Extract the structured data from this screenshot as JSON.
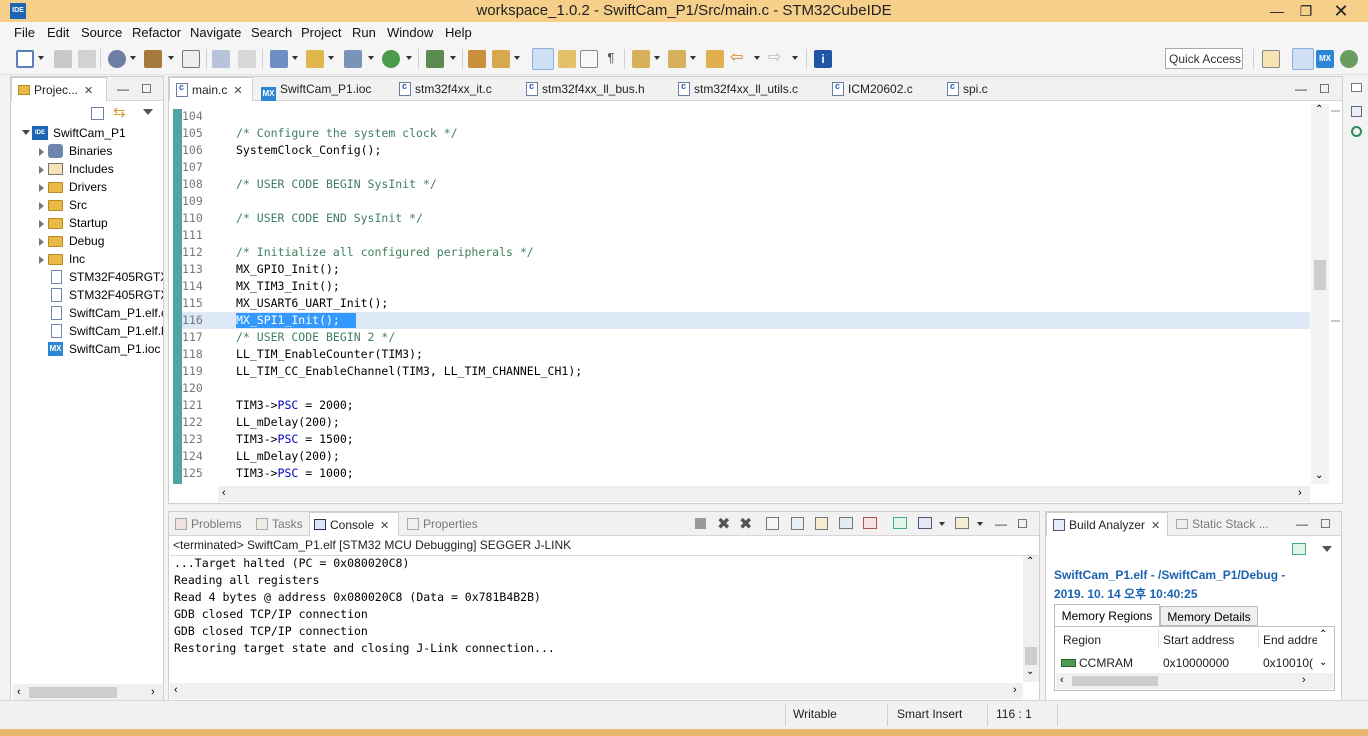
{
  "window": {
    "title": "workspace_1.0.2 - SwiftCam_P1/Src/main.c - STM32CubeIDE",
    "app_icon": "IDE",
    "minimize": "—",
    "restore": "❐",
    "close": "✕"
  },
  "menu": [
    "File",
    "Edit",
    "Source",
    "Refactor",
    "Navigate",
    "Search",
    "Project",
    "Run",
    "Window",
    "Help"
  ],
  "quick_access": "Quick Access",
  "project_explorer": {
    "tab_label": "Projec...",
    "project": "SwiftCam_P1",
    "items": [
      {
        "label": "Binaries",
        "kind": "binaries",
        "expandable": true
      },
      {
        "label": "Includes",
        "kind": "includes",
        "expandable": true
      },
      {
        "label": "Drivers",
        "kind": "folder",
        "expandable": true
      },
      {
        "label": "Src",
        "kind": "folder",
        "expandable": true
      },
      {
        "label": "Startup",
        "kind": "folder",
        "expandable": true
      },
      {
        "label": "Debug",
        "kind": "folder",
        "expandable": true
      },
      {
        "label": "Inc",
        "kind": "folder",
        "expandable": true
      },
      {
        "label": "STM32F405RGTX",
        "kind": "file",
        "expandable": false
      },
      {
        "label": "STM32F405RGTX",
        "kind": "file",
        "expandable": false
      },
      {
        "label": "SwiftCam_P1.elf.c",
        "kind": "file",
        "expandable": false
      },
      {
        "label": "SwiftCam_P1.elf.l",
        "kind": "file",
        "expandable": false
      },
      {
        "label": "SwiftCam_P1.ioc",
        "kind": "mx",
        "expandable": false
      }
    ]
  },
  "editor": {
    "tabs": [
      {
        "label": "main.c",
        "icon": "c-file",
        "active": true
      },
      {
        "label": "SwiftCam_P1.ioc",
        "icon": "mx",
        "active": false
      },
      {
        "label": "stm32f4xx_it.c",
        "icon": "c-file",
        "active": false
      },
      {
        "label": "stm32f4xx_ll_bus.h",
        "icon": "h-file",
        "active": false
      },
      {
        "label": "stm32f4xx_ll_utils.c",
        "icon": "c-file",
        "active": false
      },
      {
        "label": "ICM20602.c",
        "icon": "c-file",
        "active": false
      },
      {
        "label": "spi.c",
        "icon": "c-file",
        "active": false
      }
    ],
    "highlighted_line": "116",
    "lines": [
      {
        "n": "104",
        "text": "",
        "type": "code"
      },
      {
        "n": "105",
        "text": "/* Configure the system clock */",
        "type": "comment"
      },
      {
        "n": "106",
        "text": "SystemClock_Config();",
        "type": "code"
      },
      {
        "n": "107",
        "text": "",
        "type": "code"
      },
      {
        "n": "108",
        "text": "/* USER CODE BEGIN SysInit */",
        "type": "comment"
      },
      {
        "n": "109",
        "text": "",
        "type": "code"
      },
      {
        "n": "110",
        "text": "/* USER CODE END SysInit */",
        "type": "comment"
      },
      {
        "n": "111",
        "text": "",
        "type": "code"
      },
      {
        "n": "112",
        "text": "/* Initialize all configured peripherals */",
        "type": "comment"
      },
      {
        "n": "113",
        "text": "MX_GPIO_Init();",
        "type": "code"
      },
      {
        "n": "114",
        "text": "MX_TIM3_Init();",
        "type": "code"
      },
      {
        "n": "115",
        "text": "MX_USART6_UART_Init();",
        "type": "code"
      },
      {
        "n": "116",
        "text": "MX_SPI1_Init();",
        "type": "code"
      },
      {
        "n": "117",
        "text": "/* USER CODE BEGIN 2 */",
        "type": "comment"
      },
      {
        "n": "118",
        "text": "LL_TIM_EnableCounter(TIM3);",
        "type": "code"
      },
      {
        "n": "119",
        "text": "LL_TIM_CC_EnableChannel(TIM3, LL_TIM_CHANNEL_CH1);",
        "type": "code"
      },
      {
        "n": "120",
        "text": "",
        "type": "code"
      },
      {
        "n": "121",
        "pre": "TIM3->",
        "field": "PSC",
        "post": " = 2000;",
        "type": "field"
      },
      {
        "n": "122",
        "text": "LL_mDelay(200);",
        "type": "code"
      },
      {
        "n": "123",
        "pre": "TIM3->",
        "field": "PSC",
        "post": " = 1500;",
        "type": "field"
      },
      {
        "n": "124",
        "text": "LL_mDelay(200);",
        "type": "code"
      },
      {
        "n": "125",
        "pre": "TIM3->",
        "field": "PSC",
        "post": " = 1000;",
        "type": "field"
      }
    ]
  },
  "bottom_panel": {
    "tabs": [
      {
        "label": "Problems",
        "active": false
      },
      {
        "label": "Tasks",
        "active": false
      },
      {
        "label": "Console",
        "active": true
      },
      {
        "label": "Properties",
        "active": false
      }
    ],
    "console_header": "<terminated> SwiftCam_P1.elf [STM32 MCU Debugging] SEGGER J-LINK",
    "console_lines": [
      "...Target halted (PC = 0x080020C8)",
      "Reading all registers",
      "Read 4 bytes @ address 0x080020C8 (Data = 0x781B4B2B)",
      "GDB closed TCP/IP connection",
      "GDB closed TCP/IP connection",
      "Restoring target state and closing J-Link connection..."
    ]
  },
  "build_analyzer": {
    "tab_label": "Build Analyzer",
    "tab2_label": "Static Stack ...",
    "header_line1": "SwiftCam_P1.elf - /SwiftCam_P1/Debug -",
    "header_line2": "2019. 10. 14 오후 10:40:25",
    "subtabs": [
      "Memory Regions",
      "Memory Details"
    ],
    "columns": [
      "Region",
      "Start address",
      "End addre"
    ],
    "rows": [
      {
        "region": "CCMRAM",
        "start": "0x10000000",
        "end": "0x10010("
      }
    ]
  },
  "status_bar": {
    "writable": "Writable",
    "insert_mode": "Smart Insert",
    "position": "116 : 1"
  },
  "colors": {
    "title_bar": "#f6d08a",
    "accent_blue": "#1b63b0",
    "comment_green": "#3f7f5f",
    "field_blue": "#0000c0",
    "highlight": "#dde8f7",
    "change_ruler": "#4fa6a0"
  }
}
